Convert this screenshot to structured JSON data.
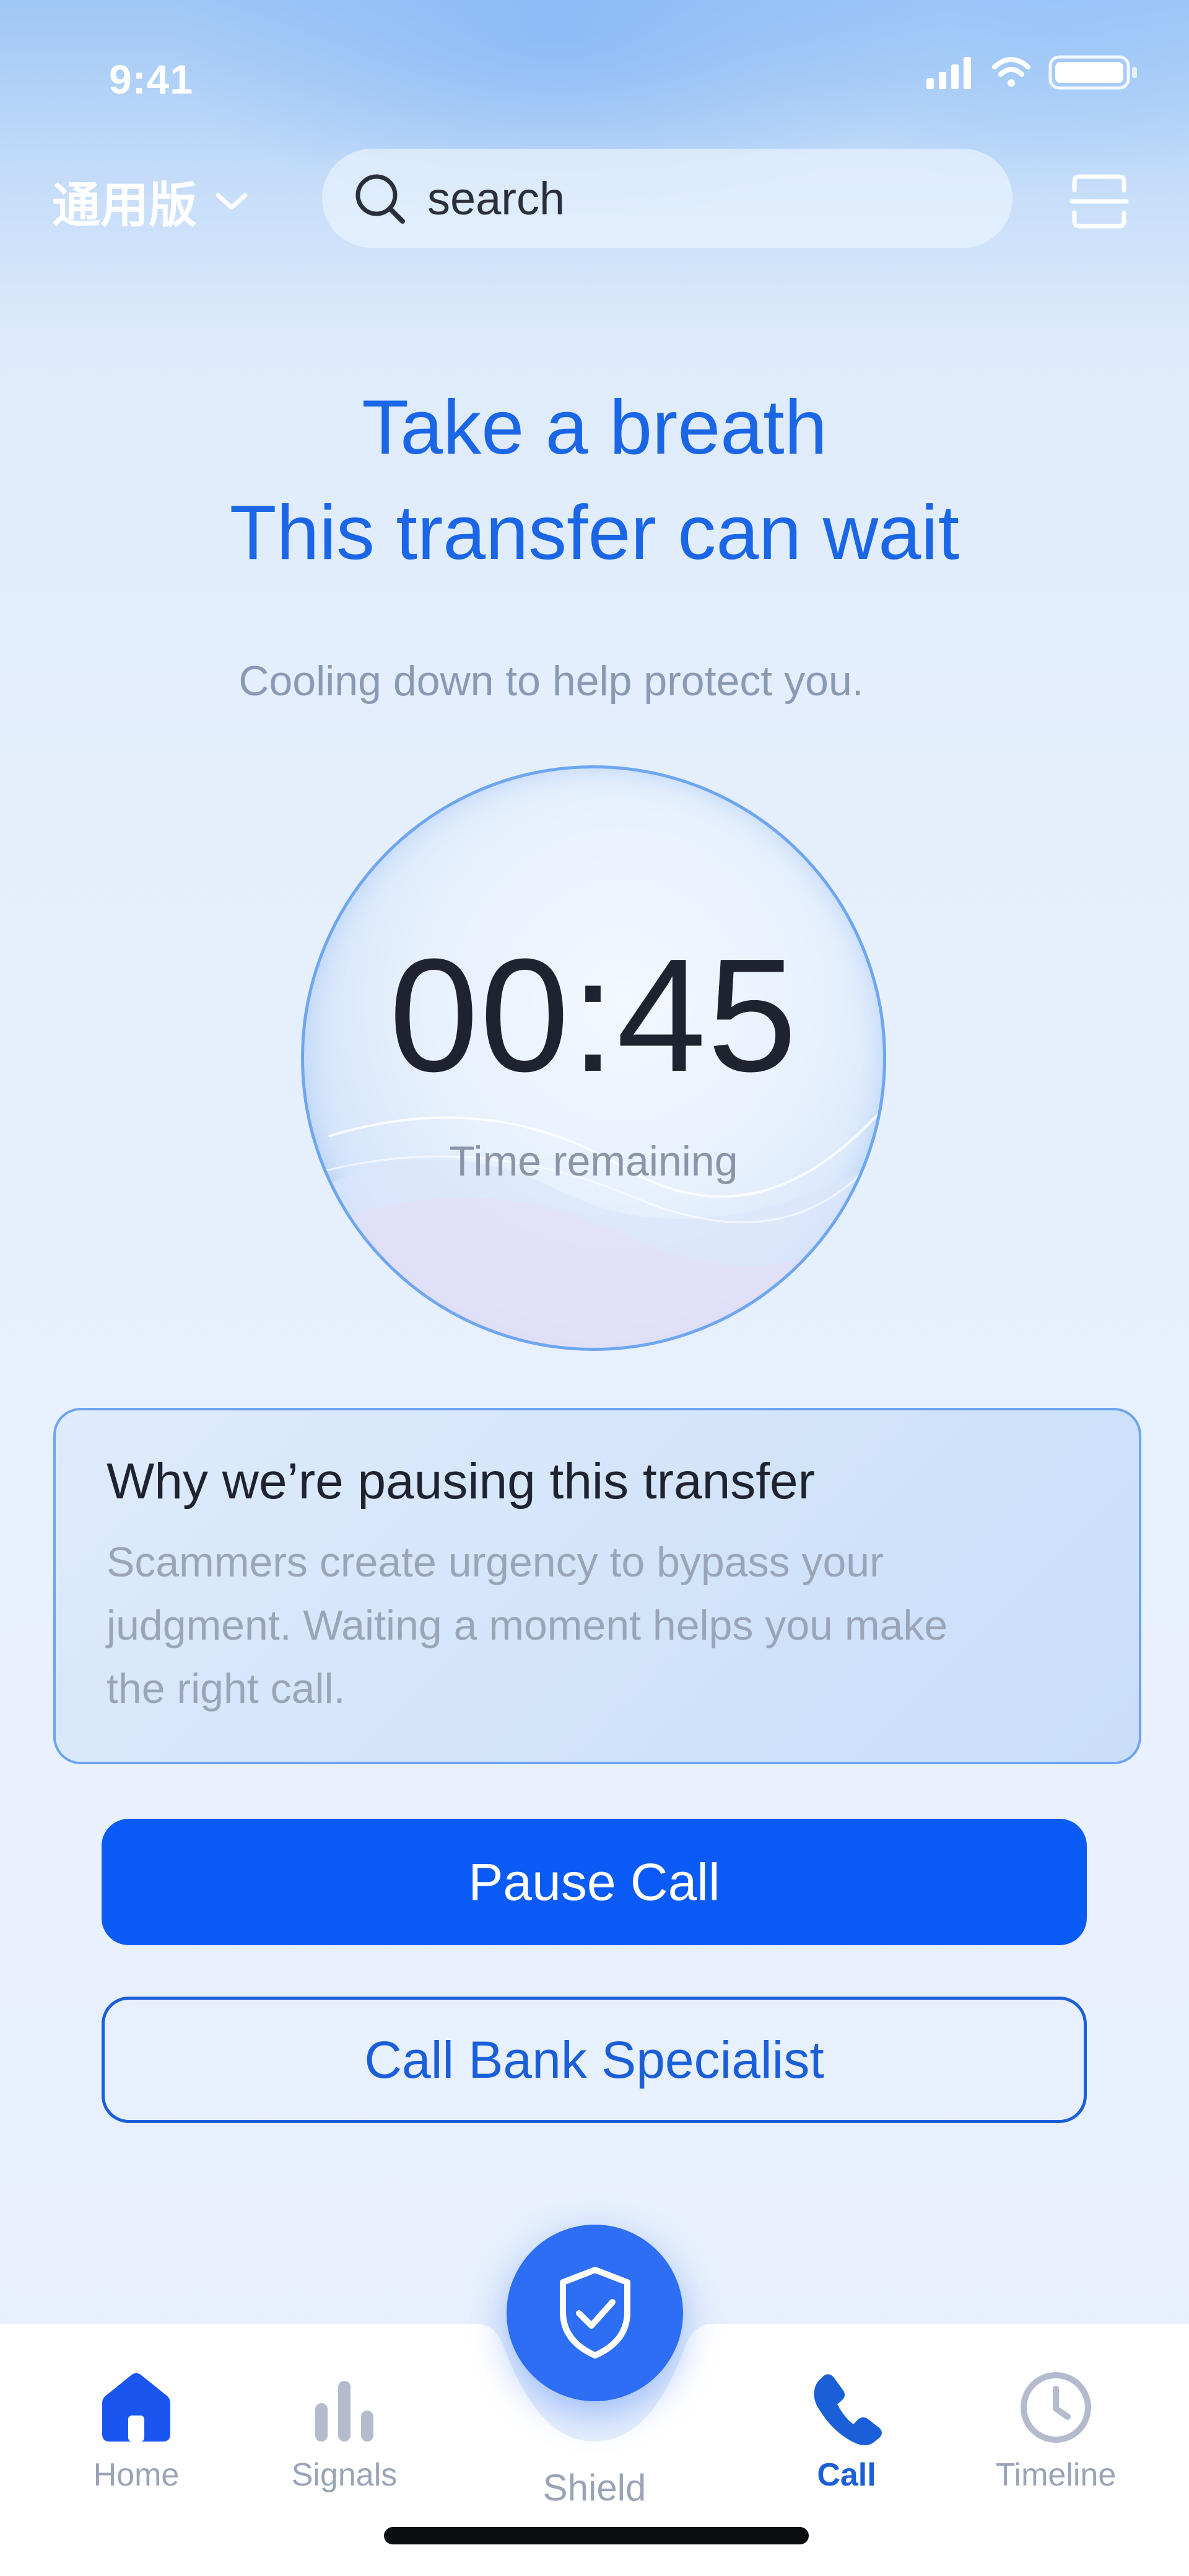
{
  "status_bar": {
    "time": "9:41"
  },
  "header": {
    "region": "通用版",
    "search_placeholder": "search"
  },
  "hero": {
    "headline_line1": "Take a breath",
    "headline_line2": "This transfer can wait",
    "subtitle": "Cooling down to help protect you."
  },
  "timer": {
    "value": "00:45",
    "label": "Time remaining"
  },
  "info_card": {
    "title": "Why we’re pausing this transfer",
    "body": "Scammers create urgency to bypass your judgment. Waiting a moment helps you make the right call."
  },
  "actions": {
    "primary": "Pause Call",
    "secondary": "Call Bank Specialist"
  },
  "tabbar": {
    "home": "Home",
    "signals": "Signals",
    "shield": "Shield",
    "call": "Call",
    "timeline": "Timeline",
    "active": "call"
  },
  "colors": {
    "accent": "#0a5af5",
    "headline": "#1a66e6",
    "shield": "#2d6ef5"
  }
}
